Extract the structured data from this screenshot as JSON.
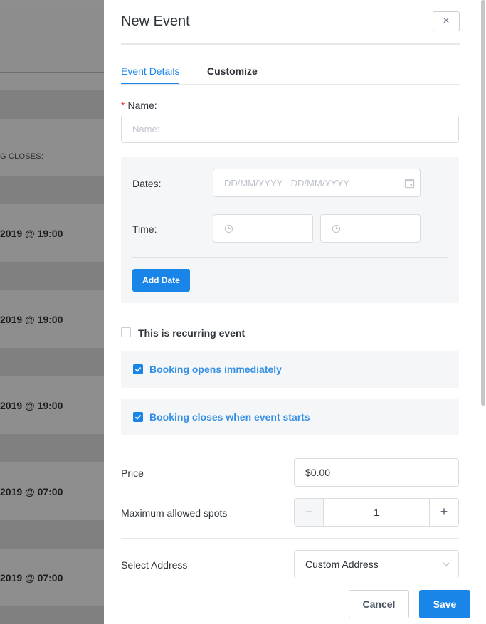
{
  "background": {
    "booking_closes_label": "G CLOSES:",
    "rows": [
      {
        "date": "2019 @ 19:00"
      },
      {
        "date": "2019 @ 19:00"
      },
      {
        "date": "2019 @ 19:00"
      },
      {
        "date": "2019 @ 07:00"
      },
      {
        "date": "2019 @ 07:00"
      }
    ]
  },
  "drawer": {
    "title": "New Event",
    "close_symbol": "×",
    "tabs": [
      {
        "label": "Event Details",
        "active": true
      },
      {
        "label": "Customize",
        "active": false
      }
    ],
    "name": {
      "required_mark": "*",
      "label": "Name:",
      "placeholder": "Name:"
    },
    "dates": {
      "label": "Dates:",
      "placeholder": "DD/MM/YYYY - DD/MM/YYYY",
      "time_label": "Time:",
      "add_date_label": "Add Date"
    },
    "recurring": {
      "label": "This is recurring event",
      "checked": false
    },
    "booking_opens": {
      "label": "Booking opens immediately",
      "checked": true
    },
    "booking_closes": {
      "label": "Booking closes when event starts",
      "checked": true
    },
    "price": {
      "label": "Price",
      "value": "$0.00"
    },
    "spots": {
      "label": "Maximum allowed spots",
      "value": "1",
      "minus": "−",
      "plus": "+"
    },
    "address": {
      "label": "Select Address",
      "value": "Custom Address"
    },
    "footer": {
      "cancel_label": "Cancel",
      "save_label": "Save"
    }
  },
  "colors": {
    "accent": "#1a85e8",
    "required": "#e53935",
    "overlay": "#8e8e8e"
  }
}
